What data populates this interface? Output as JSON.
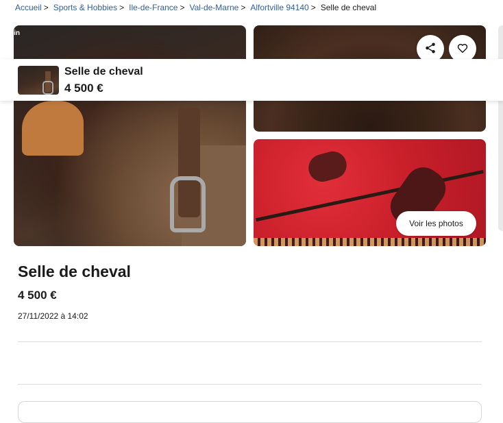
{
  "breadcrumb": {
    "items": [
      {
        "label": "Accueil"
      },
      {
        "label": "Sports & Hobbies"
      },
      {
        "label": "Ile-de-France"
      },
      {
        "label": "Val-de-Marne"
      },
      {
        "label": "Alfortville 94140"
      }
    ],
    "current": "Selle de cheval",
    "separator": ">"
  },
  "gallery": {
    "see_photos_label": "Voir les photos",
    "corner_label": "oin"
  },
  "icons": {
    "share": "share-icon",
    "favorite": "heart-icon"
  },
  "sticky_header": {
    "title": "Selle de cheval",
    "price": "4 500 €"
  },
  "listing": {
    "title": "Selle de cheval",
    "price": "4 500 €",
    "date": "27/11/2022 à 14:02"
  },
  "colors": {
    "link": "#2f5f9e",
    "text": "#1a1a1a",
    "divider": "#dcdcdc"
  }
}
